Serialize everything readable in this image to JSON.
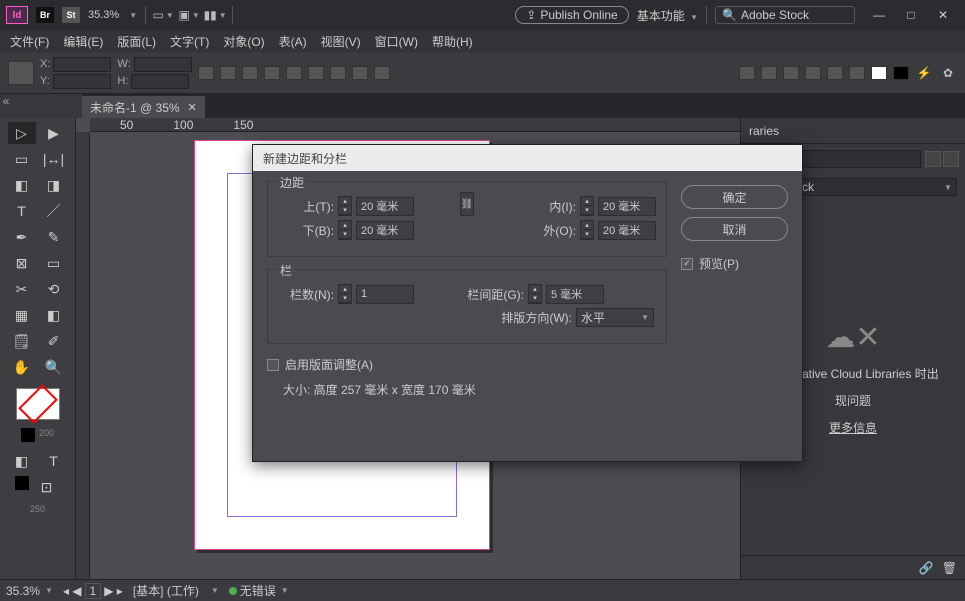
{
  "app": {
    "logo": "Id",
    "br": "Br",
    "st": "St",
    "zoom": "35.3%",
    "publish": "Publish Online",
    "workspace": "基本功能",
    "search_placeholder": "Adobe Stock"
  },
  "window": {
    "min": "—",
    "max": "□",
    "close": "✕"
  },
  "menu": [
    "文件(F)",
    "编辑(E)",
    "版面(L)",
    "文字(T)",
    "对象(O)",
    "表(A)",
    "视图(V)",
    "窗口(W)",
    "帮助(H)"
  ],
  "ctrl": {
    "x": "X:",
    "y": "Y:",
    "w": "W:",
    "h": "H:"
  },
  "tab": {
    "name": "未命名-1 @ 35%"
  },
  "ruler": [
    "50",
    "100",
    "150"
  ],
  "rpanel": {
    "tab": "raries",
    "search": "dobe Stock",
    "error1": "匕 Creative Cloud Libraries 时出",
    "error2": "现问题",
    "more": "更多信息"
  },
  "dialog": {
    "title": "新建边距和分栏",
    "ok": "确定",
    "cancel": "取消",
    "preview": "预览(P)",
    "grp_margin": "边距",
    "top": "上(T):",
    "top_v": "20 毫米",
    "bottom": "下(B):",
    "bottom_v": "20 毫米",
    "inside": "内(I):",
    "inside_v": "20 毫米",
    "outside": "外(O):",
    "outside_v": "20 毫米",
    "grp_col": "栏",
    "cols": "栏数(N):",
    "cols_v": "1",
    "gutter": "栏间距(G):",
    "gutter_v": "5 毫米",
    "dir": "排版方向(W):",
    "dir_v": "水平",
    "layout_adjust": "启用版面调整(A)",
    "size": "大小: 高度 257 毫米 x 宽度 170 毫米"
  },
  "status": {
    "zoom": "35.3%",
    "master": "[基本] (工作)",
    "err": "无错误"
  }
}
